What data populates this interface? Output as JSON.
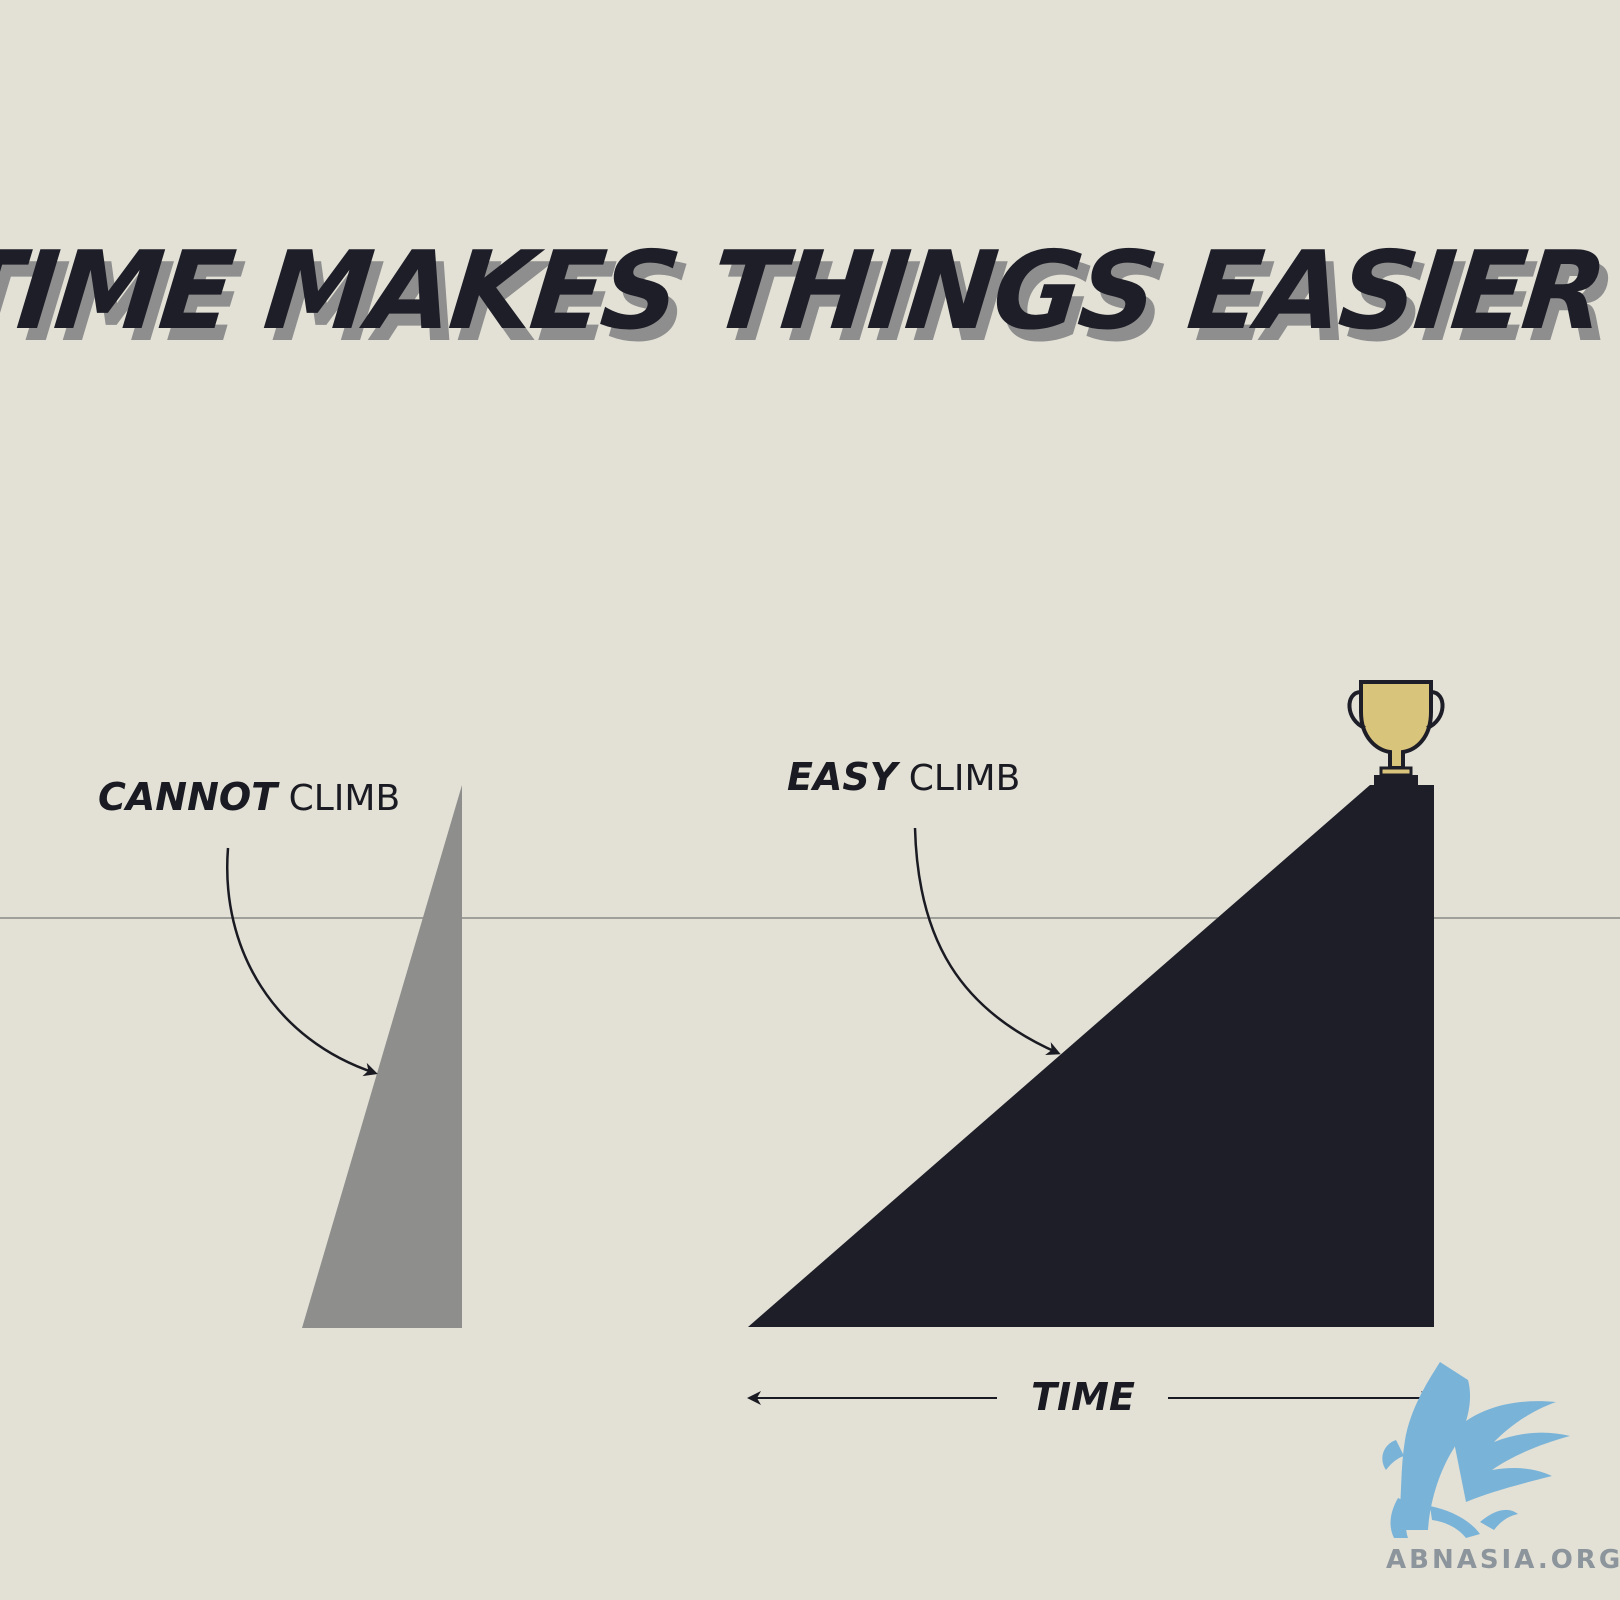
{
  "title": "TIME MAKES THINGS EASIER",
  "left_label": {
    "strong": "CANNOT",
    "plain": " CLIMB"
  },
  "right_label": {
    "strong": "EASY",
    "plain": " CLIMB"
  },
  "axis_label": "TIME",
  "watermark": "ABNASIA.ORG",
  "icons": {
    "trophy": "trophy-icon",
    "griffin": "griffin-logo"
  },
  "colors": {
    "background": "#e3e1d6",
    "title": "#1e1e28",
    "title_shadow": "#8e8e8e",
    "steep_triangle": "#8e8e8c",
    "gentle_triangle": "#1e1e28",
    "trophy": "#d9c47c",
    "logo": "#7ab3d8"
  }
}
